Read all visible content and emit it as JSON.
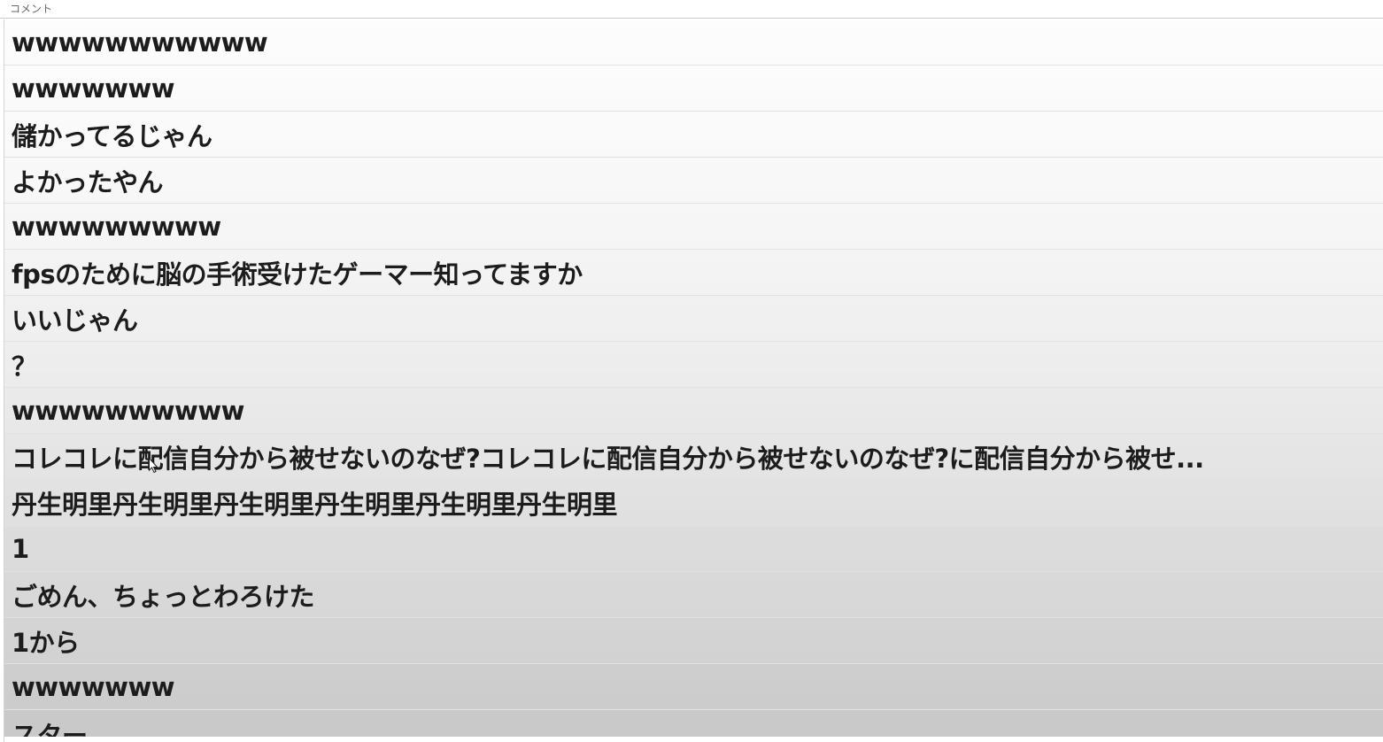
{
  "header": {
    "column_label": "コメント"
  },
  "comments": [
    "wwwwwwwwwww",
    "wwwwwww",
    "儲かってるじゃん",
    "よかったやん",
    "wwwwwwwww",
    "fpsのために脳の手術受けたゲーマー知ってますか",
    "いいじゃん",
    "？",
    "wwwwwwwwww",
    "コレコレに配信自分から被せないのなぜ?コレコレに配信自分から被せないのなぜ?に配信自分から被せ...",
    "丹生明里丹生明里丹生明里丹生明里丹生明里丹生明里",
    "1",
    "ごめん、ちょっとわろけた",
    "1から",
    "wwwwwww",
    "スター..."
  ],
  "colors": {
    "row_gradient_top": "#fdfdfd",
    "row_gradient_bottom": "#c9c9c9",
    "text": "#1c1c1c",
    "divider": "#e2e2e2"
  }
}
